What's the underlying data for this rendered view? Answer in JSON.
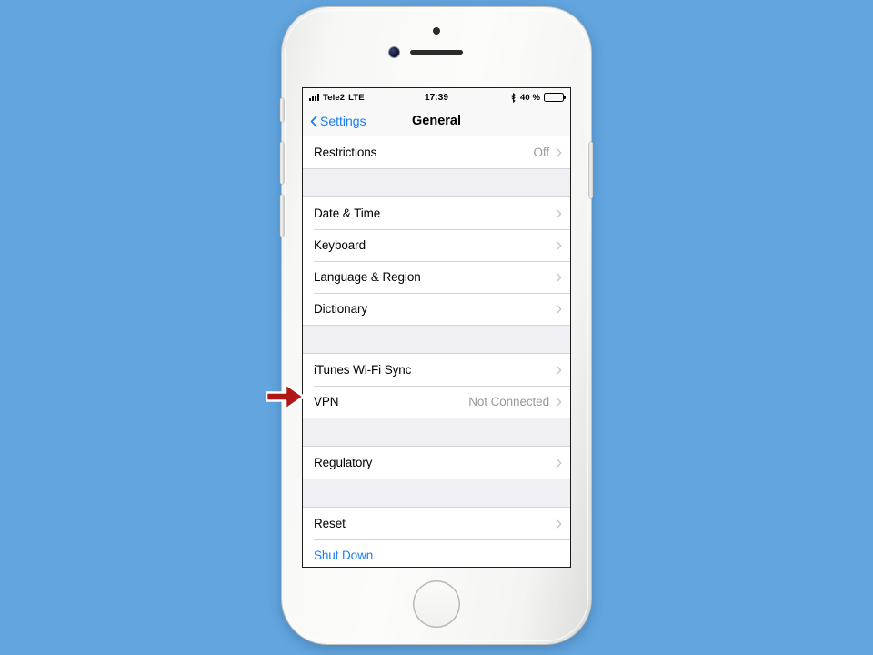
{
  "device": {
    "name": "iphone-white-silver",
    "frame_color": "#f7f7f6",
    "home_button": "home-button"
  },
  "annotation": {
    "arrow_color": "#b01717",
    "arrow_outline": "#ffffff",
    "points_at": "VPN"
  },
  "background": {
    "color": "#62a5df"
  },
  "status_bar": {
    "signal_icon": "signal-bars-icon",
    "carrier": "Tele2",
    "network_type": "LTE",
    "time": "17:39",
    "bluetooth_icon": "bluetooth-icon",
    "battery_percent_label": "40 %",
    "battery_level": 40,
    "battery_icon": "battery-icon"
  },
  "nav_bar": {
    "back_icon": "chevron-left-icon",
    "back_label": "Settings",
    "title": "General"
  },
  "list": {
    "groups": [
      {
        "rows": [
          {
            "label": "Restrictions",
            "value": "Off",
            "chevron": true,
            "link": false
          }
        ]
      },
      {
        "rows": [
          {
            "label": "Date & Time",
            "value": "",
            "chevron": true,
            "link": false
          },
          {
            "label": "Keyboard",
            "value": "",
            "chevron": true,
            "link": false
          },
          {
            "label": "Language & Region",
            "value": "",
            "chevron": true,
            "link": false
          },
          {
            "label": "Dictionary",
            "value": "",
            "chevron": true,
            "link": false
          }
        ]
      },
      {
        "rows": [
          {
            "label": "iTunes Wi-Fi Sync",
            "value": "",
            "chevron": true,
            "link": false
          },
          {
            "label": "VPN",
            "value": "Not Connected",
            "chevron": true,
            "link": false
          }
        ]
      },
      {
        "rows": [
          {
            "label": "Regulatory",
            "value": "",
            "chevron": true,
            "link": false
          }
        ]
      },
      {
        "rows": [
          {
            "label": "Reset",
            "value": "",
            "chevron": true,
            "link": false
          },
          {
            "label": "Shut Down",
            "value": "",
            "chevron": false,
            "link": true
          }
        ]
      }
    ]
  },
  "colors": {
    "accent_blue": "#1a7cf5",
    "list_background": "#efeff4",
    "row_background": "#ffffff",
    "separator": "#d3d3d8",
    "secondary_text": "#9a9a9f"
  }
}
